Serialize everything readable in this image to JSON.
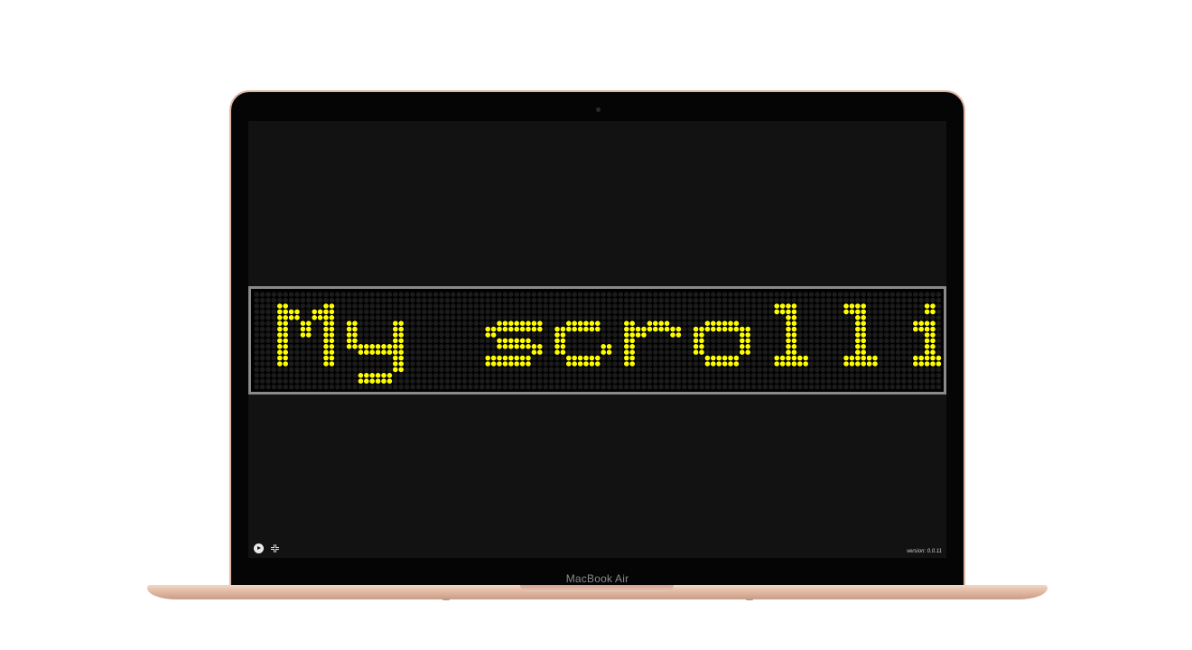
{
  "device": {
    "brand_label": "MacBook Air"
  },
  "led_display": {
    "message": "My scrolling mess",
    "led_on_color": "#ffff00",
    "led_off_color": "#1b1b1b",
    "border_color": "#8a8a8a"
  },
  "controls": {
    "play_icon": "play-icon",
    "fullscreen_icon": "fullscreen-icon"
  },
  "footer": {
    "version_text": "version: 0.0.11"
  }
}
